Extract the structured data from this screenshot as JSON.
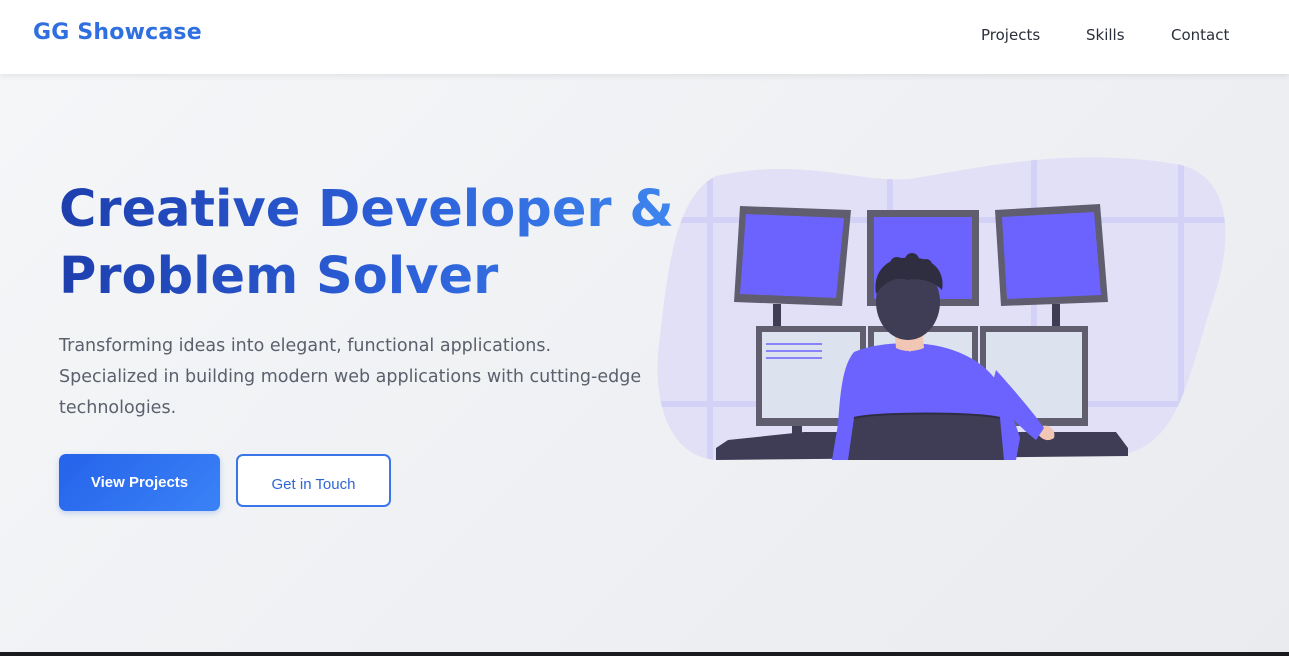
{
  "nav": {
    "brand": "GG Showcase",
    "links": [
      "Projects",
      "Skills",
      "Contact"
    ]
  },
  "hero": {
    "title_line1": "Creative Developer &",
    "title_line2": "Problem Solver",
    "description": "Transforming ideas into elegant, functional applications. Specialized in building modern web applications with cutting-edge technologies.",
    "primary_button": "View Projects",
    "secondary_button": "Get in Touch"
  },
  "colors": {
    "brand": "#2f6fe0",
    "accent": "#2563eb",
    "illustration_purple": "#6c63ff",
    "illustration_dark": "#3f3d56"
  },
  "illustration": {
    "icon": "developer-at-workstation-illustration"
  }
}
